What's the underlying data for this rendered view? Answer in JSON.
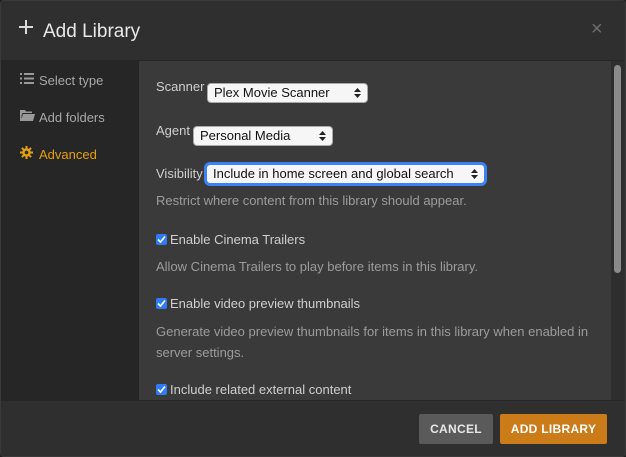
{
  "header": {
    "title": "Add Library",
    "close": "×"
  },
  "sidebar": {
    "items": [
      {
        "label": "Select type",
        "icon": "list-icon",
        "active": false
      },
      {
        "label": "Add folders",
        "icon": "folder-icon",
        "active": false
      },
      {
        "label": "Advanced",
        "icon": "gear-icon",
        "active": true
      }
    ]
  },
  "form": {
    "scanner_label": "Scanner",
    "scanner_value": "Plex Movie Scanner",
    "agent_label": "Agent",
    "agent_value": "Personal Media",
    "visibility_label": "Visibility",
    "visibility_value": "Include in home screen and global search",
    "visibility_help": "Restrict where content from this library should appear.",
    "cinema_trailers_label": "Enable Cinema Trailers",
    "cinema_trailers_help": "Allow Cinema Trailers to play before items in this library.",
    "preview_thumbnails_label": "Enable video preview thumbnails",
    "preview_thumbnails_help_line1": "Generate video preview thumbnails for items in this library when enabled in",
    "preview_thumbnails_help_line2": "server settings.",
    "external_content_label": "Include related external content"
  },
  "footer": {
    "cancel_label": "CANCEL",
    "add_label": "ADD LIBRARY"
  },
  "colors": {
    "accent": "#e5a00d",
    "primary_button": "#cc7b19",
    "checkbox": "#2f7bf5"
  }
}
